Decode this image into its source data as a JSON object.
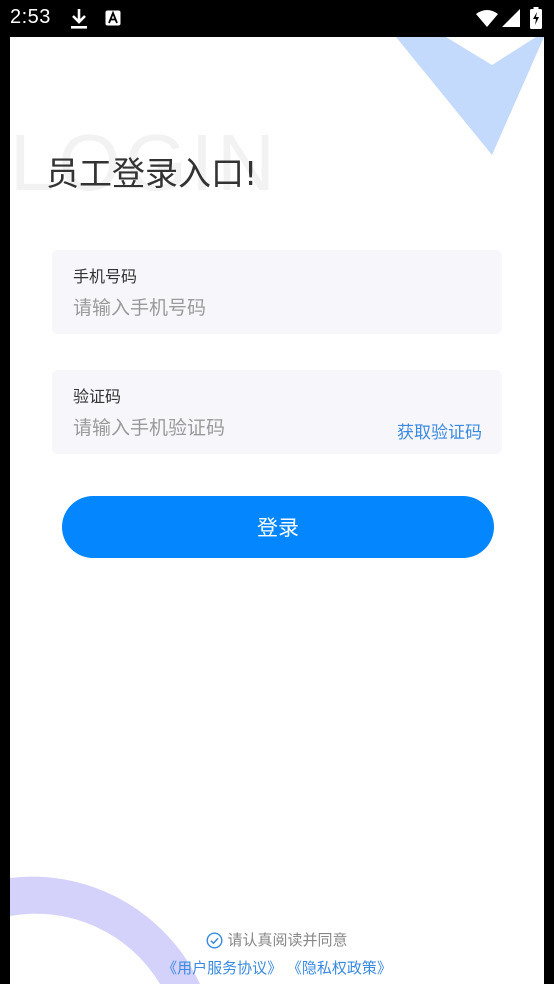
{
  "status_bar": {
    "time": "2:53",
    "icons": [
      "download-icon",
      "a-notification-icon",
      "wifi-icon",
      "signal-icon",
      "battery-charging-icon"
    ]
  },
  "colors": {
    "primary": "#0486fe",
    "link": "#3a8ae0",
    "field_bg": "#f7f6fb",
    "deco_chevron": "#c4dafc",
    "deco_circle": "#d4d1fb"
  },
  "background_watermark": "LOGIN",
  "title": "员工登录入口!",
  "phone_field": {
    "label": "手机号码",
    "placeholder": "请输入手机号码",
    "value": ""
  },
  "code_field": {
    "label": "验证码",
    "placeholder": "请输入手机验证码",
    "value": "",
    "get_code_label": "获取验证码"
  },
  "login_button": "登录",
  "agreement": {
    "text": "请认真阅读并同意",
    "user_agreement": "《用户服务协议》",
    "privacy_policy": "《隐私权政策》"
  }
}
